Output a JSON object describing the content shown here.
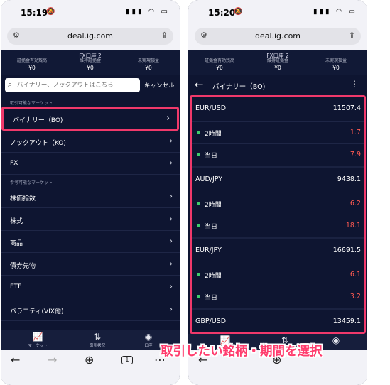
{
  "left": {
    "status": {
      "time": "15:19",
      "signal": "▮▮▮ ◠ ▭"
    },
    "url": "deal.ig.com",
    "account": {
      "title": "FX口座 2",
      "cols": [
        {
          "label": "証拠金有効残高",
          "value": "¥0"
        },
        {
          "label": "維持証拠金",
          "value": "¥0"
        },
        {
          "label": "未実現損益",
          "value": "¥0"
        }
      ]
    },
    "search": {
      "placeholder": "バイナリー、ノックアウトはこちら",
      "cancel": "キャンセル"
    },
    "section1": "取引可能なマーケット",
    "items_top": [
      {
        "label": "バイナリー（BO)"
      },
      {
        "label": "ノックアウト（KO)"
      },
      {
        "label": "FX"
      }
    ],
    "section2": "参考可能なマーケット",
    "items_bottom": [
      {
        "label": "株価指数"
      },
      {
        "label": "株式"
      },
      {
        "label": "商品"
      },
      {
        "label": "債券先物"
      },
      {
        "label": "ETF"
      },
      {
        "label": "バラエティ(VIX他)"
      }
    ],
    "nav": [
      {
        "label": "マーケット"
      },
      {
        "label": "取引状況"
      },
      {
        "label": "口座"
      }
    ],
    "browser": {
      "tabs_count": "1"
    }
  },
  "right": {
    "status": {
      "time": "15:20",
      "signal": "▮▮▮ ◠ ▭"
    },
    "url": "deal.ig.com",
    "account": {
      "title": "FX口座 2",
      "cols": [
        {
          "label": "証拠金有効残高",
          "value": "¥0"
        },
        {
          "label": "維持証拠金",
          "value": "¥0"
        },
        {
          "label": "未実現損益",
          "value": "¥0"
        }
      ]
    },
    "appbar": {
      "title": "バイナリー（BO)"
    },
    "pairs": [
      {
        "name": "EUR/USD",
        "value": "11507.4",
        "periods": [
          {
            "label": "2時間",
            "value": "1.7"
          },
          {
            "label": "当日",
            "value": "7.9"
          }
        ]
      },
      {
        "name": "AUD/JPY",
        "value": "9438.1",
        "periods": [
          {
            "label": "2時間",
            "value": "6.2"
          },
          {
            "label": "当日",
            "value": "18.1"
          }
        ]
      },
      {
        "name": "EUR/JPY",
        "value": "16691.5",
        "periods": [
          {
            "label": "2時間",
            "value": "6.1"
          },
          {
            "label": "当日",
            "value": "3.2"
          }
        ]
      },
      {
        "name": "GBP/USD",
        "value": "13459.1",
        "periods": []
      }
    ]
  },
  "caption": "取引したい銘柄・期間を選択",
  "colors": {
    "highlight": "#f0396b",
    "background": "#0e1531",
    "positive_dot": "#3dcc6a",
    "value_red": "#ff5a52"
  }
}
